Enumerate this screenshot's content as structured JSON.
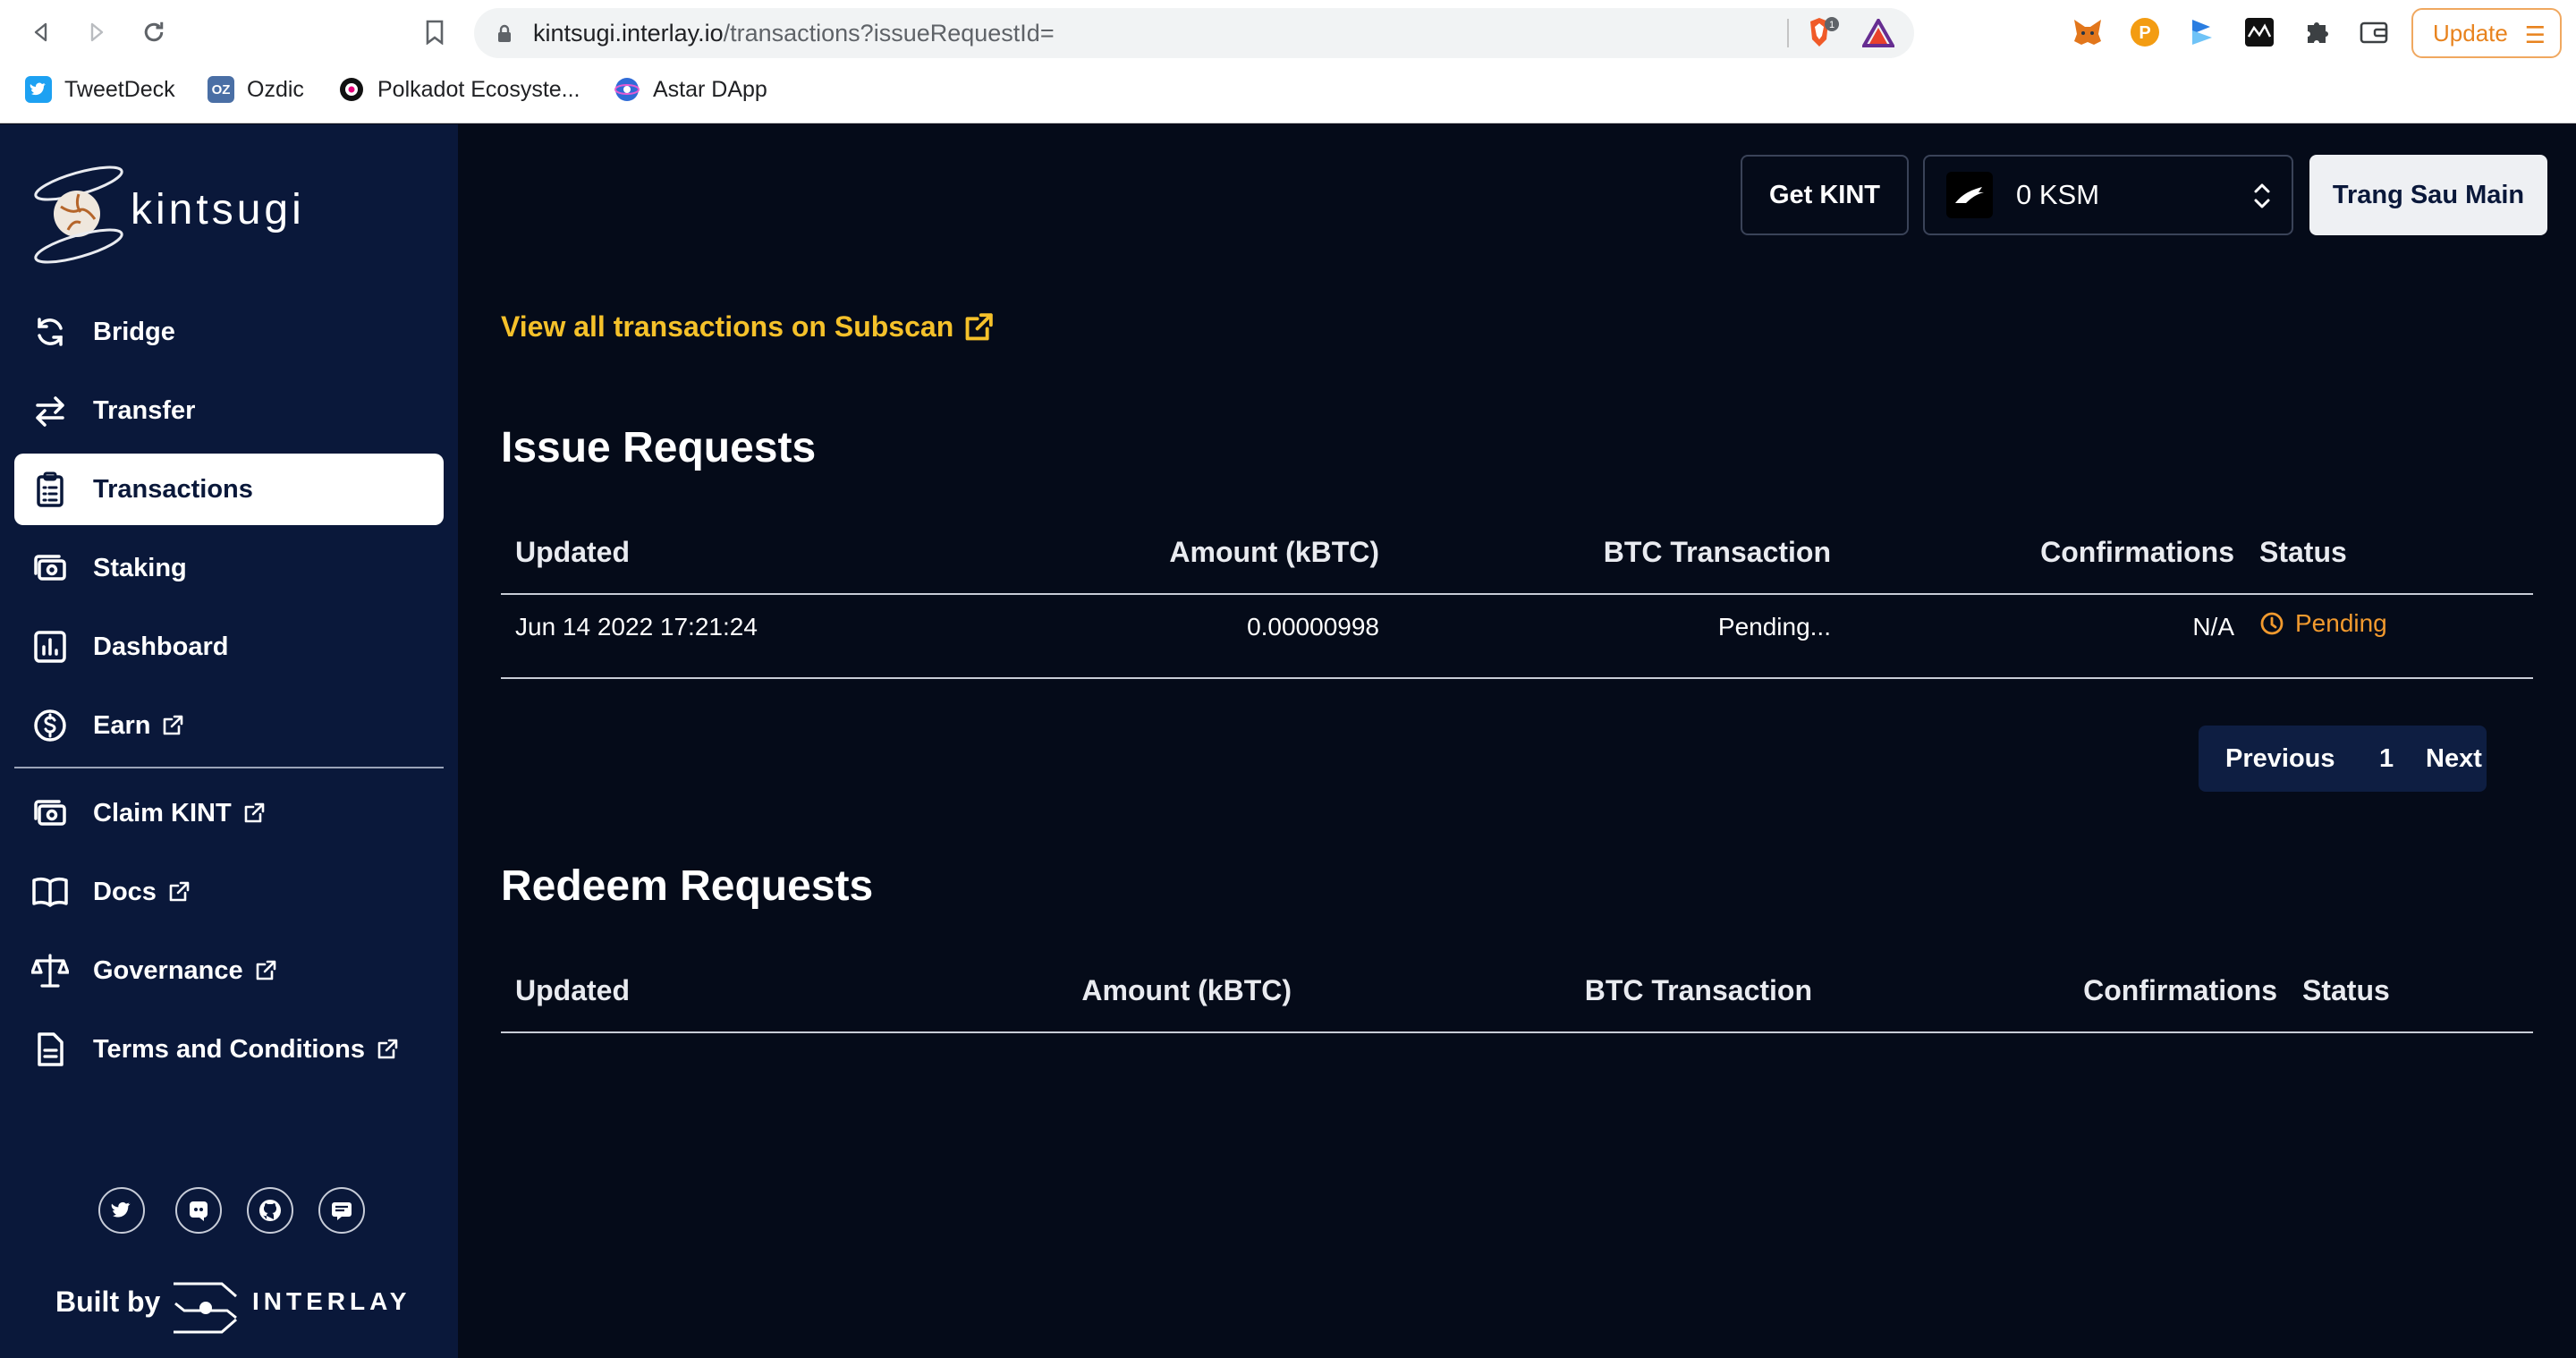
{
  "browser": {
    "url_host": "kintsugi.interlay.io",
    "url_path": "/transactions?issueRequestId=",
    "brave_badge": "1",
    "update_label": "Update",
    "bookmarks": [
      {
        "label": "TweetDeck",
        "icon": "tweetdeck-icon"
      },
      {
        "label": "Ozdic",
        "icon": "ozdic-icon"
      },
      {
        "label": "Polkadot Ecosyste...",
        "icon": "polkadot-icon"
      },
      {
        "label": "Astar DApp",
        "icon": "astar-icon"
      }
    ]
  },
  "sidebar": {
    "logo_text": "kintsugi",
    "nav": [
      {
        "label": "Bridge",
        "icon": "bridge-icon"
      },
      {
        "label": "Transfer",
        "icon": "transfer-icon"
      },
      {
        "label": "Transactions",
        "icon": "clipboard-icon",
        "active": true
      },
      {
        "label": "Staking",
        "icon": "staking-icon"
      },
      {
        "label": "Dashboard",
        "icon": "dashboard-icon"
      },
      {
        "label": "Earn",
        "icon": "dollar-icon",
        "external": true
      }
    ],
    "nav_secondary": [
      {
        "label": "Claim KINT",
        "icon": "claim-icon",
        "external": true
      },
      {
        "label": "Docs",
        "icon": "book-icon",
        "external": true
      },
      {
        "label": "Governance",
        "icon": "scale-icon",
        "external": true
      },
      {
        "label": "Terms and Conditions",
        "icon": "document-icon",
        "external": true
      }
    ],
    "social": [
      "twitter-icon",
      "discord-icon",
      "github-icon",
      "subsocial-icon"
    ],
    "built_by": "Built by",
    "built_by_brand": "INTERLAY"
  },
  "header": {
    "get_kint": "Get KINT",
    "balance": "0 KSM",
    "account": "Trang Sau Main"
  },
  "main": {
    "subscan_link": "View all transactions on Subscan",
    "issue": {
      "title": "Issue Requests",
      "columns": [
        "Updated",
        "Amount (kBTC)",
        "BTC Transaction",
        "Confirmations",
        "Status"
      ],
      "rows": [
        {
          "updated": "Jun 14 2022 17:21:24",
          "amount": "0.00000998",
          "btc_tx": "Pending...",
          "confirmations": "N/A",
          "status": "Pending"
        }
      ],
      "pagination": {
        "previous": "Previous",
        "page": "1",
        "next": "Next"
      }
    },
    "redeem": {
      "title": "Redeem Requests",
      "columns": [
        "Updated",
        "Amount (kBTC)",
        "BTC Transaction",
        "Confirmations",
        "Status"
      ],
      "rows": []
    }
  },
  "colors": {
    "sidebar_bg": "#0a183a",
    "main_bg": "#050b19",
    "link_yellow": "#f5c12a",
    "status_pending": "#f29a2e"
  }
}
